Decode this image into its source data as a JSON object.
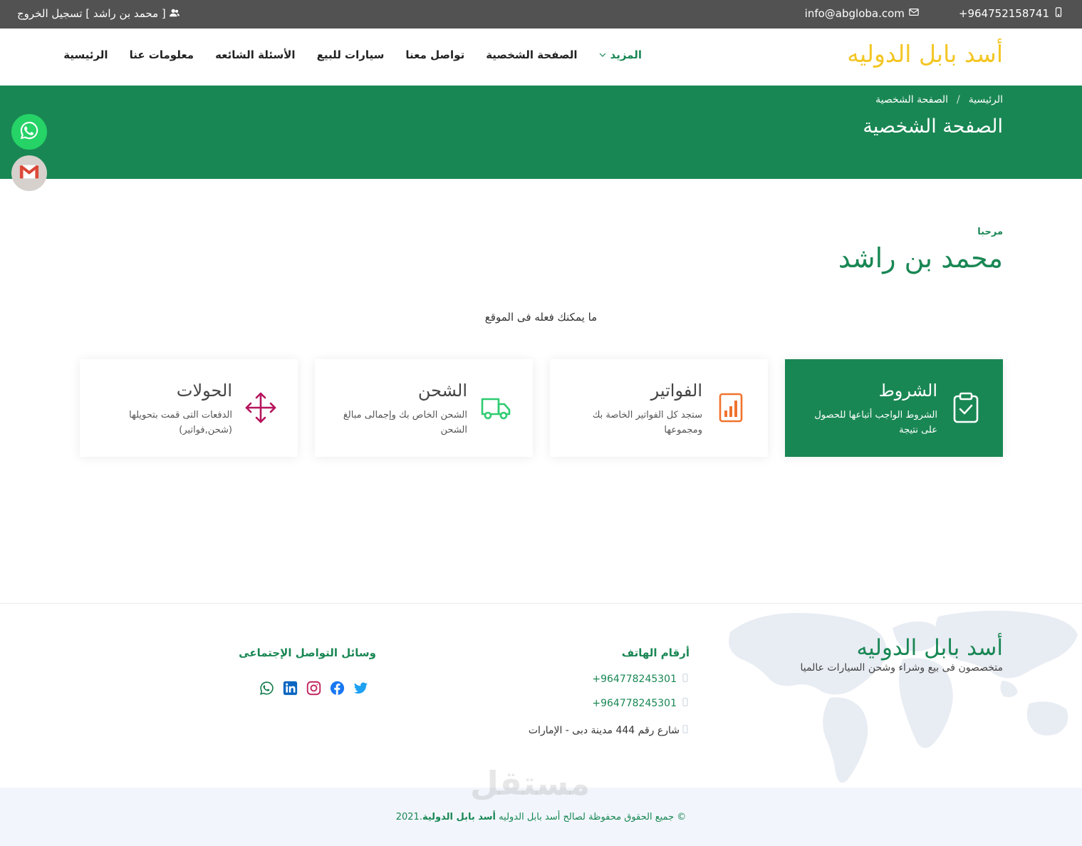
{
  "topbar": {
    "user_label": "[ محمد بن راشد ] تسجيل الخروج",
    "email": "info@abgloba.com",
    "phone": "+964752158741",
    "bg_color": "#525252"
  },
  "header": {
    "brand": "أسد بابل الدوليه",
    "brand_color": "#f3c623",
    "nav": [
      "الرئيسية",
      "معلومات عنا",
      "الأسئلة الشائعه",
      "سيارات للبيع",
      "تواصل معنا",
      "الصفحة الشخصية",
      "المزيد"
    ]
  },
  "hero": {
    "bg_color": "#198754",
    "breadcrumb_home": "الرئيسية",
    "breadcrumb_sep": "/",
    "breadcrumb_current": "الصفحة الشخصية",
    "title": "الصفحة الشخصية"
  },
  "floating": {
    "whatsapp_icon": "whatsapp-icon",
    "gmail_icon": "gmail-icon"
  },
  "profile": {
    "welcome": "مرحبا",
    "name": "محمد بن راشد",
    "subtitle": "ما يمكنك فعله فى الموقع"
  },
  "cards": [
    {
      "title": "الشروط",
      "desc": "الشروط الواجب أتباعها للحصول على نتيجة",
      "icon": "clipboard-check-icon",
      "active": true
    },
    {
      "title": "الفواتير",
      "desc": "ستجد كل الفواتير الخاصة بك ومجموعها",
      "icon": "chart-bars-icon",
      "active": false,
      "icon_color": "#f0732e"
    },
    {
      "title": "الشحن",
      "desc": "الشحن الخاص بك وإجمالى مبالغ الشحن",
      "icon": "truck-icon",
      "active": false,
      "icon_color": "#2ecc71"
    },
    {
      "title": "الحولات",
      "desc": "الدفعات التى قمت بتحويلها (شحن,فواتير)",
      "icon": "arrows-move-icon",
      "active": false,
      "icon_color": "#b5145c"
    }
  ],
  "footer": {
    "brand": "أسد بابل الدوليه",
    "tagline": "متخصصون فى بيع وشراء وشحن السيارات عالميا",
    "phones_title": "أرقام الهاتف",
    "phones": [
      "+964778245301",
      "+964778245301"
    ],
    "address": "شارع رقم 444 مدينة دبى - الإمارات",
    "social_title": "وسائل التواصل الإجتماعى",
    "social_icons": [
      "whatsapp-icon",
      "linkedin-icon",
      "instagram-icon",
      "facebook-icon",
      "twitter-icon"
    ]
  },
  "copyright": {
    "prefix": "© جميع الحقوق محفوظة لصالح أسد بابل الدوليه",
    "brand": "أسد بابل الدولية",
    "year": ".2021"
  },
  "watermark": "مستقل"
}
